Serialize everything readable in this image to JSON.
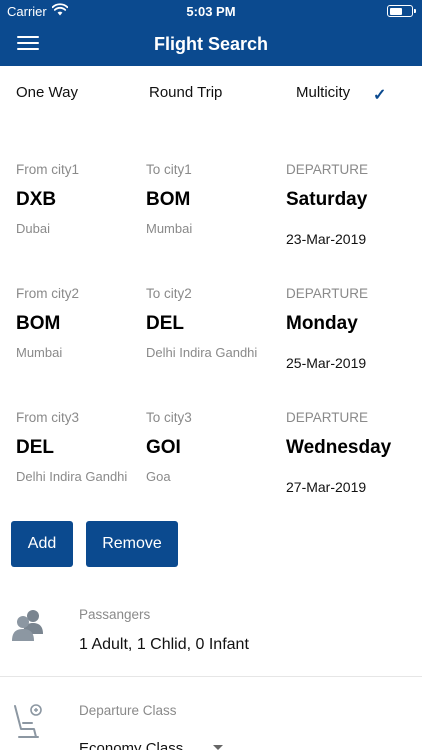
{
  "status_bar": {
    "carrier": "Carrier",
    "time": "5:03 PM"
  },
  "nav": {
    "title": "Flight Search"
  },
  "trip_types": [
    {
      "label": "One Way",
      "selected": false
    },
    {
      "label": "Round Trip",
      "selected": false
    },
    {
      "label": "Multicity",
      "selected": true
    }
  ],
  "check_mark": "✓",
  "legs": [
    {
      "from_label": "From city1",
      "from_code": "DXB",
      "from_city": "Dubai",
      "to_label": "To city1",
      "to_code": "BOM",
      "to_city": "Mumbai",
      "dep_label": "DEPARTURE",
      "dep_day": "Saturday",
      "dep_date": "23-Mar-2019"
    },
    {
      "from_label": "From city2",
      "from_code": "BOM",
      "from_city": "Mumbai",
      "to_label": "To city2",
      "to_code": "DEL",
      "to_city": "Delhi Indira Gandhi",
      "dep_label": "DEPARTURE",
      "dep_day": "Monday",
      "dep_date": "25-Mar-2019"
    },
    {
      "from_label": "From city3",
      "from_code": "DEL",
      "from_city": "Delhi Indira Gandhi",
      "to_label": "To city3",
      "to_code": "GOI",
      "to_city": "Goa",
      "dep_label": "DEPARTURE",
      "dep_day": "Wednesday",
      "dep_date": "27-Mar-2019"
    }
  ],
  "buttons": {
    "add": "Add",
    "remove": "Remove"
  },
  "passengers": {
    "label": "Passangers",
    "value": "1 Adult, 1 Chlid, 0 Infant"
  },
  "departure_class": {
    "label": "Departure Class",
    "value": "Economy Class"
  },
  "colors": {
    "primary": "#0b4a8f",
    "muted": "#8a8a8a"
  },
  "icons": {
    "passengers": "people-icon",
    "seat": "seat-icon",
    "menu": "hamburger-menu-icon"
  }
}
